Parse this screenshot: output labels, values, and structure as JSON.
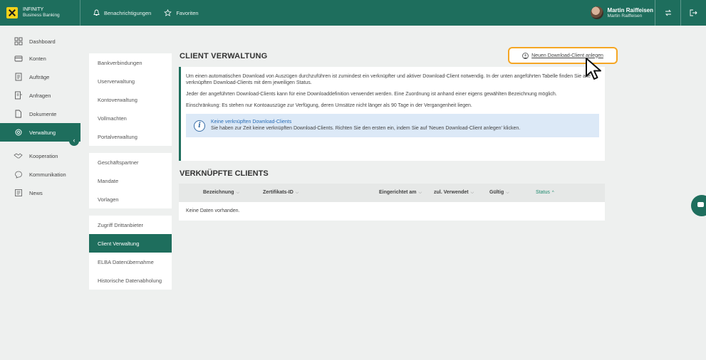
{
  "header": {
    "brand_line1": "INFINITY",
    "brand_line2": "Business Banking",
    "notifications": "Benachrichtigungen",
    "favorites": "Favoriten",
    "user_name": "Martin Raiffeisen",
    "user_sub": "Martin Raiffeisen"
  },
  "sidebar": {
    "items": [
      {
        "label": "Dashboard",
        "icon": "dashboard-icon"
      },
      {
        "label": "Konten",
        "icon": "wallet-icon"
      },
      {
        "label": "Aufträge",
        "icon": "orders-icon"
      },
      {
        "label": "Anfragen",
        "icon": "requests-icon"
      },
      {
        "label": "Dokumente",
        "icon": "document-icon"
      },
      {
        "label": "Verwaltung",
        "icon": "gear-icon"
      },
      {
        "label": "Kooperation",
        "icon": "handshake-icon"
      },
      {
        "label": "Kommunikation",
        "icon": "chat-icon"
      },
      {
        "label": "News",
        "icon": "news-icon"
      }
    ],
    "active": "Verwaltung"
  },
  "subnav": {
    "group1": [
      "Bankverbindungen",
      "Userverwaltung",
      "Kontoverwaltung",
      "Vollmachten",
      "Portalverwaltung"
    ],
    "group2": [
      "Geschäftspartner",
      "Mandate",
      "Vorlagen"
    ],
    "group3": [
      "Zugriff Drittanbieter",
      "Client Verwaltung",
      "ELBA Datenübernahme",
      "Historische Datenabholung"
    ],
    "active": "Client Verwaltung"
  },
  "main": {
    "title": "CLIENT VERWALTUNG",
    "new_client_label": "Neuen Download-Client anlegen",
    "info_p1": "Um einen automatischen Download von Auszügen durchzuführen ist zumindest ein verknüpfter und aktiver Download-Client notwendig. In der unten angeführten Tabelle finden Sie alle verknüpften Download-Clients mit dem jeweiligen Status.",
    "info_p2": "Jeder der angeführten Download-Clients kann für eine Downloaddefinition verwendet werden. Eine Zuordnung ist anhand einer eigens gewählten Bezeichnung möglich.",
    "info_p3": "Einschränkung: Es stehen nur Kontoauszüge zur Verfügung, deren Umsätze nicht länger als 90 Tage in der Vergangenheit liegen.",
    "notice_title": "Keine verknüpften Download-Clients",
    "notice_text": "Sie haben zur Zeit keine verknüpften Download-Clients. Richten Sie den ersten ein, indem Sie auf 'Neuen Download-Client anlegen' klicken.",
    "linked_title": "VERKNÜPFTE CLIENTS",
    "table": {
      "columns": [
        "Bezeichnung",
        "Zertifikats-ID",
        "Eingerichtet am",
        "zul. Verwendet",
        "Gültig",
        "Status"
      ],
      "empty": "Keine Daten vorhanden."
    }
  },
  "colors": {
    "primary": "#1e6e5d",
    "highlight": "#f5a623",
    "notice_bg": "#dce9f7"
  }
}
